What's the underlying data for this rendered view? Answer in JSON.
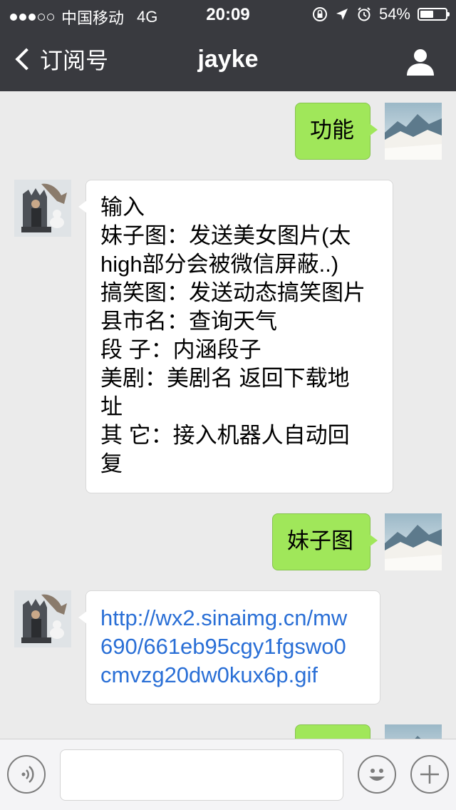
{
  "status_bar": {
    "carrier": "中国移动",
    "network": "4G",
    "time": "20:09",
    "battery": "54%",
    "battery_level": 0.54,
    "signal_strength": 3
  },
  "nav": {
    "back_label": "订阅号",
    "title": "jayke",
    "profile_icon": "person-icon"
  },
  "messages": [
    {
      "dir": "out",
      "text": "功能"
    },
    {
      "dir": "in",
      "lines": [
        "输入",
        "妹子图：发送美女图片(太",
        "high部分会被微信屏蔽..)",
        "搞笑图：发送动态搞笑图片",
        "县市名：查询天气",
        "段 子：内涵段子",
        "美剧：美剧名  返回下载地",
        "址",
        "其 它：接入机器人自动回",
        "复"
      ]
    },
    {
      "dir": "out",
      "text": "妹子图"
    },
    {
      "dir": "in",
      "link_lines": [
        "http://wx2.sinaimg.cn/mw",
        "690/661eb95cgy1fgswo0",
        "cmvzg20dw0kux6p.gif"
      ]
    }
  ],
  "input_bar": {
    "voice_icon": "voice-icon",
    "text_value": "",
    "emoji_icon": "emoji-icon",
    "plus_icon": "plus-icon"
  },
  "colors": {
    "nav_bg": "#393a3f",
    "chat_bg": "#ebebeb",
    "out_bubble": "#a0e75a",
    "in_bubble": "#ffffff",
    "link": "#2a6fd6"
  }
}
